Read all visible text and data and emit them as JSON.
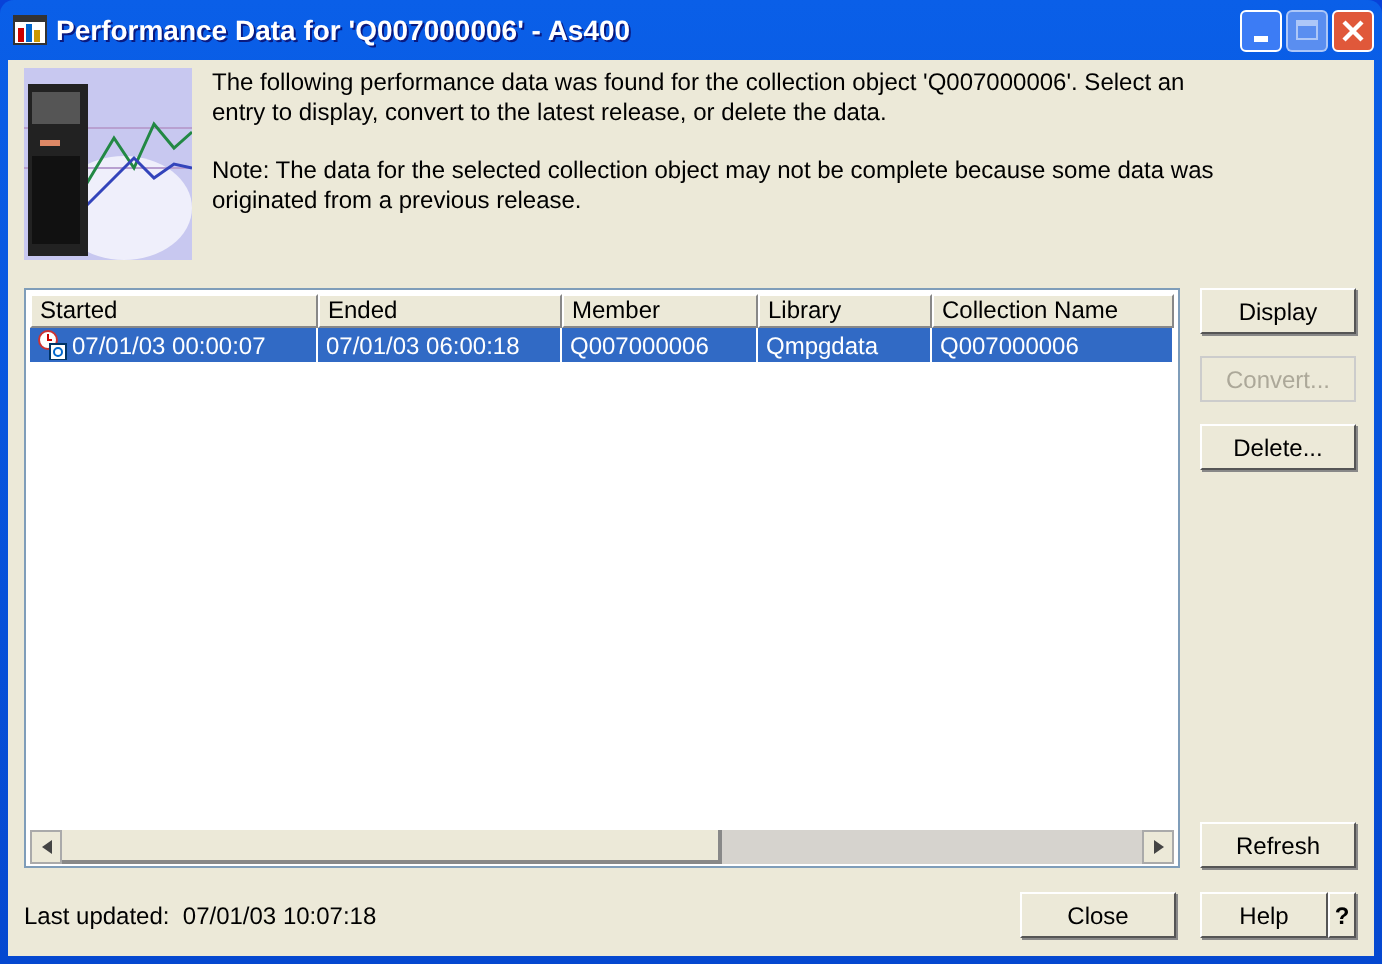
{
  "window": {
    "title": "Performance Data for 'Q007000006' - As400"
  },
  "description": [
    "The following performance data was found for the collection object 'Q007000006'. Select an entry to display, convert to the latest release, or delete the data.",
    "Note: The data for the selected collection object may not be complete because some data was originated from a previous release."
  ],
  "table": {
    "columns": [
      "Started",
      "Ended",
      "Member",
      "Library",
      "Collection Name"
    ],
    "rows": [
      {
        "cells": [
          "07/01/03 00:00:07",
          "07/01/03 06:00:18",
          "Q007000006",
          "Qmpgdata",
          "Q007000006"
        ],
        "selected": true
      }
    ]
  },
  "side_buttons": [
    {
      "label": "Display",
      "disabled": false
    },
    {
      "label": "Convert...",
      "disabled": true
    },
    {
      "label": "Delete...",
      "disabled": false
    }
  ],
  "refresh_button": "Refresh",
  "status": "Last updated:  07/01/03 10:07:18",
  "close_button": "Close",
  "help_button": "Help",
  "help_icon_button": "?"
}
